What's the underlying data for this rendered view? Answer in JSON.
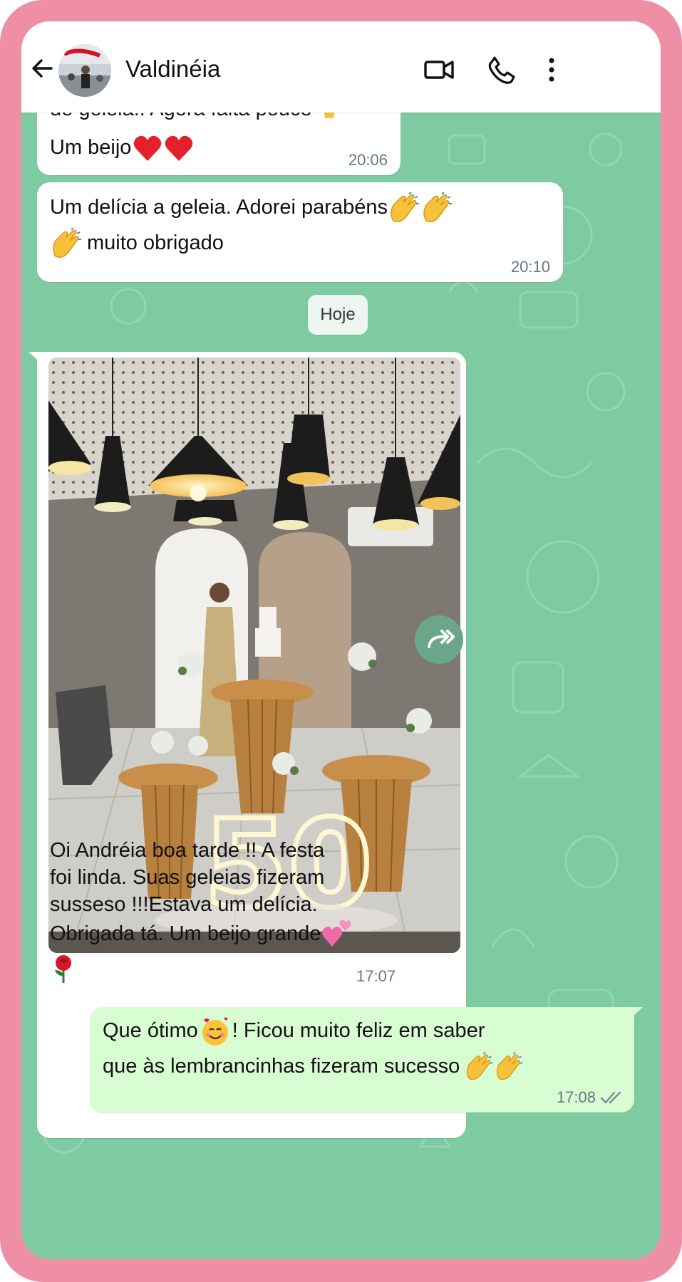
{
  "colors": {
    "frame": "#ef8fa6",
    "chat_background": "#7fcba1",
    "incoming_bubble": "#ffffff",
    "outgoing_bubble": "#d9fdd3",
    "header": "#ffffff"
  },
  "header": {
    "contact_name": "Valdinéia",
    "icons": [
      "back-arrow-icon",
      "video-call-icon",
      "voice-call-icon",
      "more-options-icon"
    ]
  },
  "messages": [
    {
      "direction": "in",
      "lines": [
        "de geleia!! Agora falta pouco",
        "Um beijo"
      ],
      "emojis": [
        "folded-hands",
        "red-heart",
        "red-heart"
      ],
      "time": "20:06"
    },
    {
      "direction": "in",
      "lines": [
        "Um delícia a geleia.  Adorei parabéns",
        "muito obrigado"
      ],
      "emojis": [
        "clapping-hands",
        "clapping-hands",
        "clapping-hands"
      ],
      "time": "20:10"
    },
    {
      "direction": "in",
      "type": "image",
      "caption_lines": [
        "Oi Andréia boa tarde !! A festa",
        "foi linda. Suas geleias fizeram",
        "susseso !!!Estava um delícia.",
        "Obrigada tá. Um beijo grande"
      ],
      "emojis": [
        "two-hearts",
        "rose"
      ],
      "image_text": "50",
      "time": "17:07"
    },
    {
      "direction": "out",
      "lines": [
        "Que ótimo",
        "! Ficou muito feliz em saber",
        "que às lembrancinhas fizeram sucesso"
      ],
      "emojis": [
        "smiling-face-with-hearts",
        "clapping-hands",
        "clapping-hands"
      ],
      "time": "17:08",
      "status": "read"
    }
  ],
  "date_chip": "Hoje"
}
